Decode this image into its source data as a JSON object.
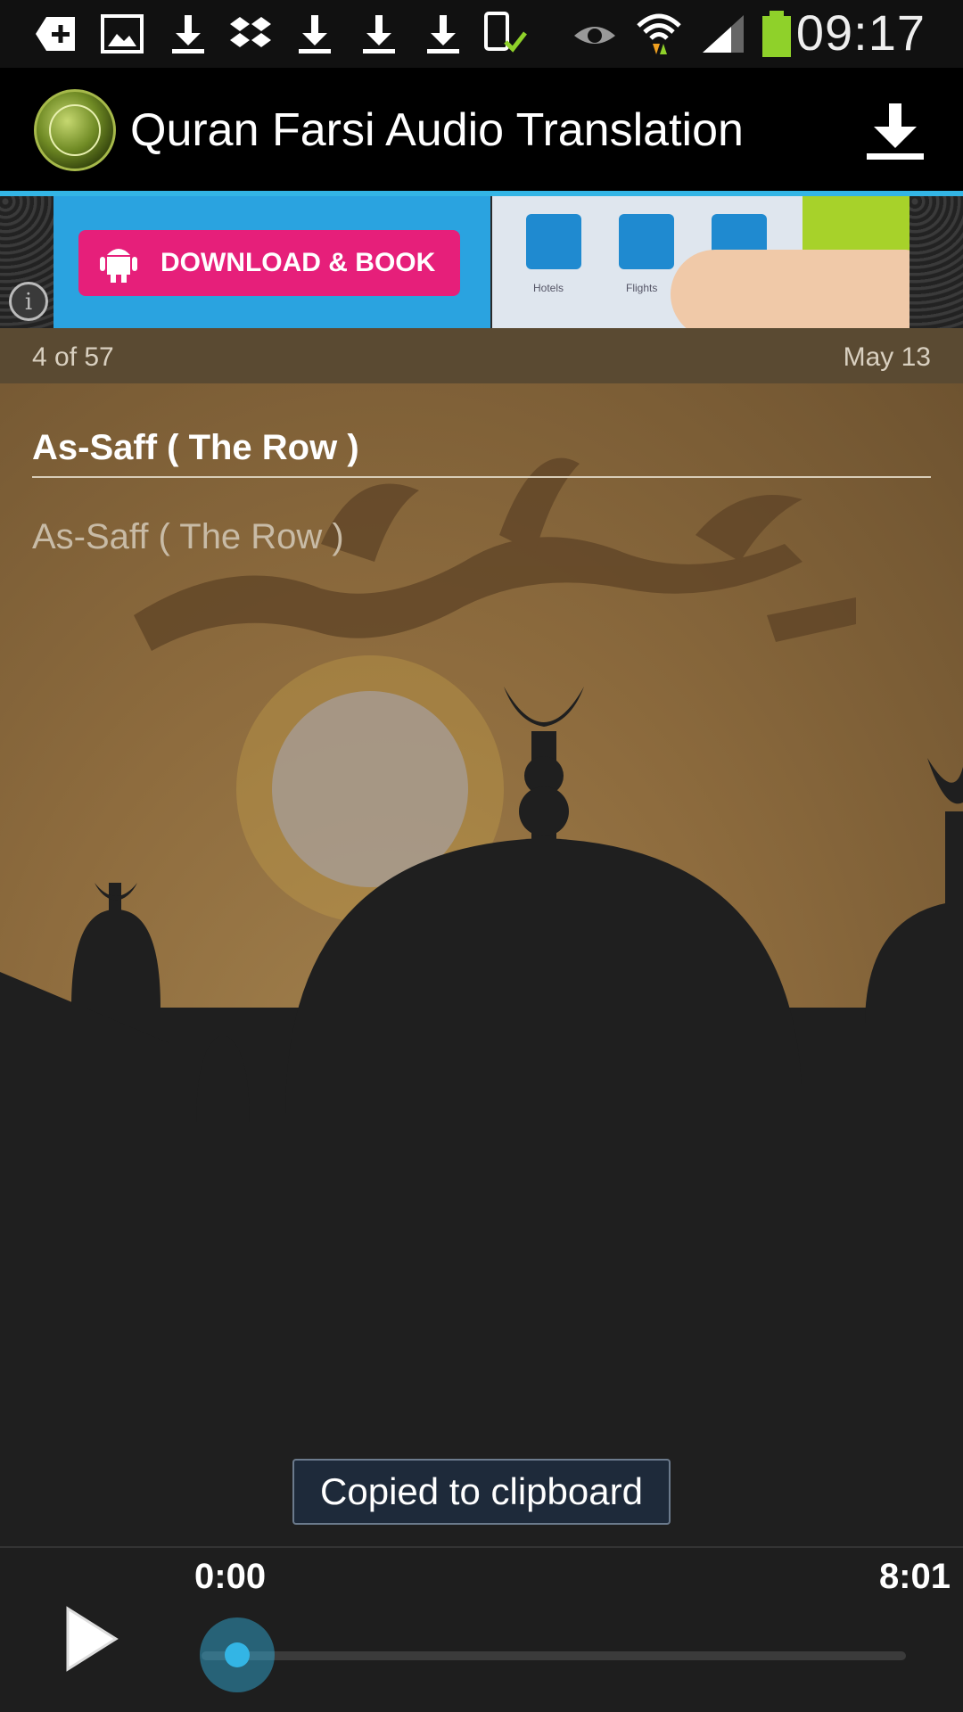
{
  "status_bar": {
    "time": "09:17",
    "icons": [
      "add-notification-icon",
      "gallery-icon",
      "download-icon",
      "dropbox-icon",
      "download-icon",
      "download-icon",
      "download-icon",
      "device-check-icon",
      "eye-icon",
      "wifi-icon",
      "signal-icon",
      "battery-icon"
    ]
  },
  "action_bar": {
    "title": "Quran Farsi Audio Translation"
  },
  "ad": {
    "cta_label": "DOWNLOAD & BOOK",
    "tiles": [
      "Hotels",
      "Flights"
    ],
    "accent": "#e61f7a"
  },
  "info": {
    "counter": "4 of 57",
    "date": "May 13"
  },
  "content": {
    "headline": "As-Saff ( The Row )",
    "subtitle": "As-Saff ( The Row )"
  },
  "toast": {
    "message": "Copied to clipboard"
  },
  "player": {
    "current_time": "0:00",
    "total_time": "8:01",
    "progress": 0
  },
  "colors": {
    "accent": "#33b5e5",
    "background": "#1e1e1e"
  }
}
